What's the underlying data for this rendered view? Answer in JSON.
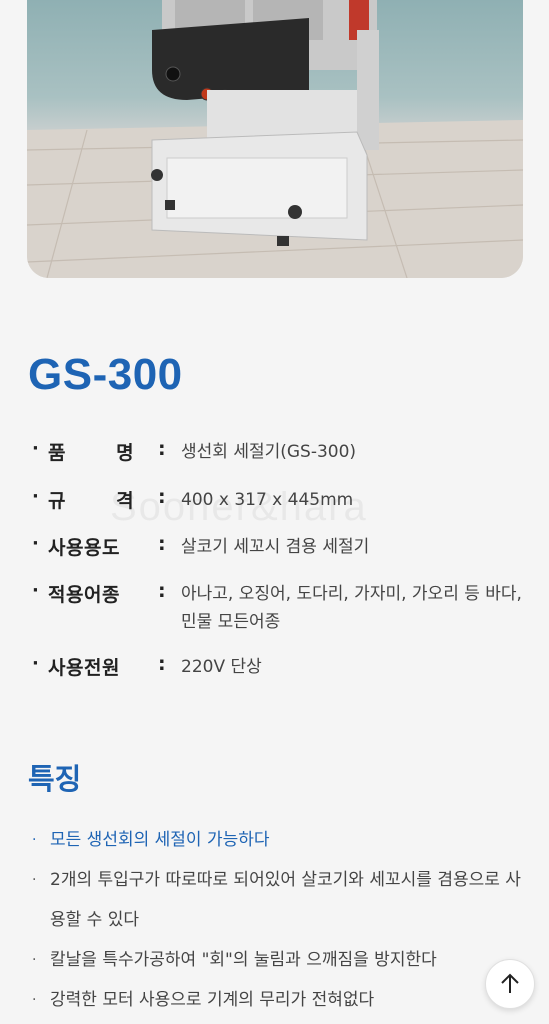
{
  "model": "GS-300",
  "watermark": "Sooner&hara",
  "specs": [
    {
      "label": "품 명",
      "value": "생선회 세절기(GS-300)"
    },
    {
      "label": "규 격",
      "value": "400 x 317 x 445mm"
    },
    {
      "label": "사용용도",
      "value": "살코기 세꼬시 겸용 세절기"
    },
    {
      "label": "적용어종",
      "value": "아나고, 오징어, 도다리, 가자미, 가오리 등 바다, 민물 모든어종"
    },
    {
      "label": "사용전원",
      "value": "220V 단상"
    }
  ],
  "features": {
    "title": "특징",
    "items": [
      "모든 생선회의 세절이 가능하다",
      "2개의 투입구가 따로따로 되어있어 살코기와 세꼬시를 겸용으로 사용할 수 있다",
      "칼날을 특수가공하여 \"회\"의 눌림과 으깨짐을 방지한다",
      "강력한 모터 사용으로 기계의 무리가 전혀없다"
    ]
  },
  "colors": {
    "accent": "#1e64b4"
  },
  "icons": {
    "scroll_top": "arrow-up-icon"
  }
}
